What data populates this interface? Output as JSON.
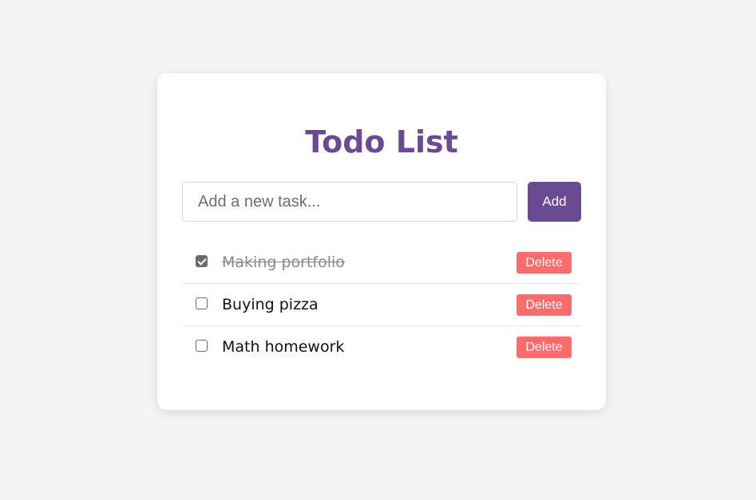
{
  "app": {
    "title": "Todo List"
  },
  "input": {
    "placeholder": "Add a new task...",
    "value": ""
  },
  "add_button": {
    "label": "Add"
  },
  "tasks": [
    {
      "text": "Making portfolio",
      "completed": true,
      "delete_label": "Delete"
    },
    {
      "text": "Buying pizza",
      "completed": false,
      "delete_label": "Delete"
    },
    {
      "text": "Math homework",
      "completed": false,
      "delete_label": "Delete"
    }
  ],
  "colors": {
    "background": "#f4f4f4",
    "card": "#ffffff",
    "accent": "#6a4a93",
    "delete": "#ff6b6b",
    "completed_text": "#8a8a8a"
  }
}
